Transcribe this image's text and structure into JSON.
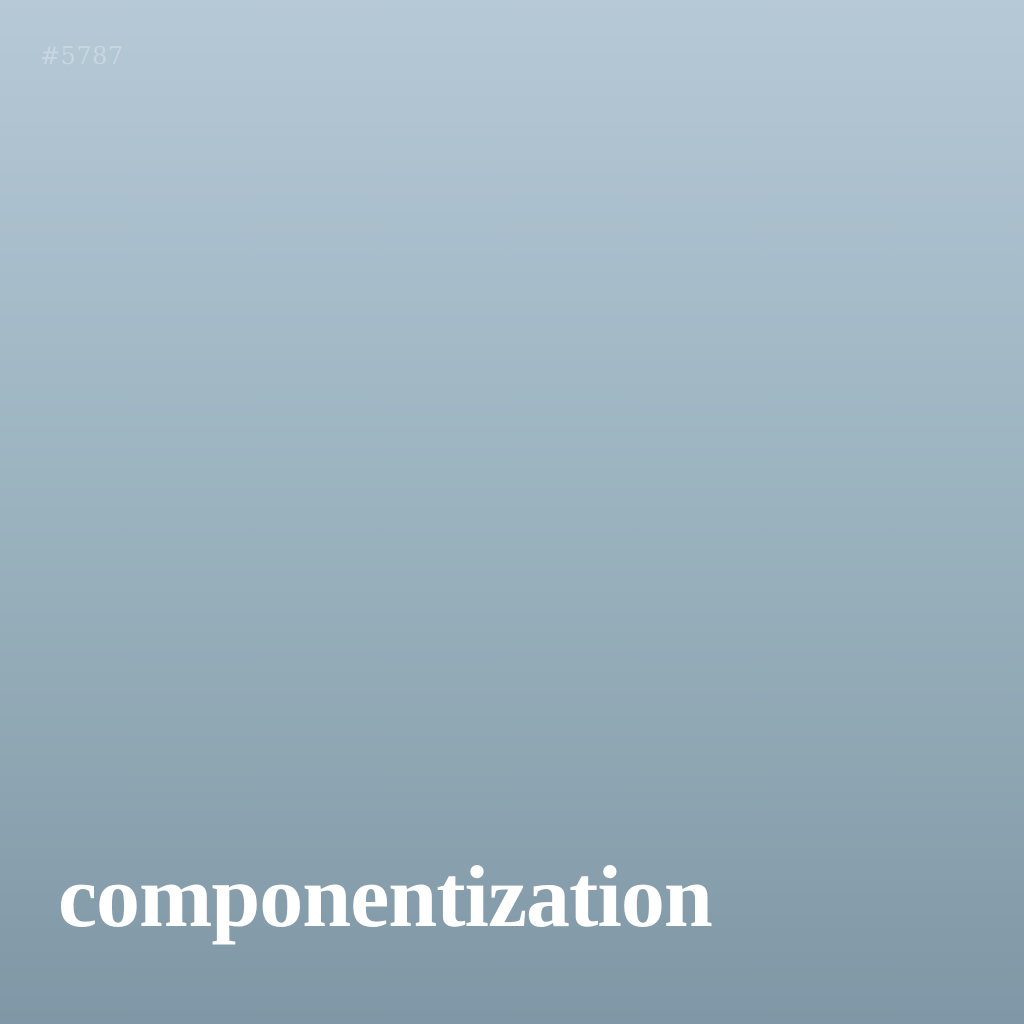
{
  "card": {
    "tag": "#5787",
    "word": "componentization"
  },
  "colors": {
    "gradient_top": "#b6c9d7",
    "gradient_bottom": "#7f97a6",
    "word_text": "#ffffff"
  }
}
